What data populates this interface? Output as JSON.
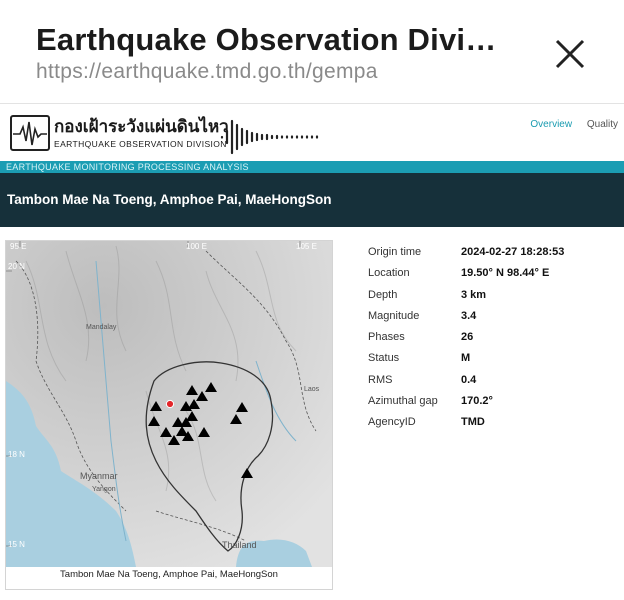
{
  "browser": {
    "page_title": "Earthquake Observation Divis…",
    "url": "https://earthquake.tmd.go.th/gempa"
  },
  "site": {
    "logo_thai": "กองเฝ้าระวังแผ่นดินไหว",
    "logo_english": "EARTHQUAKE OBSERVATION DIVISION",
    "nav": [
      "Overview",
      "Quality"
    ],
    "subtitle": "EARTHQUAKE  MONITORING  PROCESSING  ANALYSIS"
  },
  "event": {
    "title": "Tambon Mae Na Toeng, Amphoe Pai, MaeHongSon"
  },
  "map": {
    "lon_labels": [
      "95 E",
      "100 E",
      "105 E"
    ],
    "lat_labels": [
      "20 N",
      "18 N",
      "15 N"
    ],
    "place_labels": [
      "Mandalay",
      "Myanmar",
      "Yangon",
      "Laos",
      "Thailand"
    ],
    "caption": "Tambon Mae Na Toeng, Amphoe Pai, MaeHongSon",
    "epicenter_color": "#e3262a",
    "station_color": "#000000",
    "station_count": 18
  },
  "details": [
    {
      "label": "Origin time",
      "value": "2024-02-27 18:28:53"
    },
    {
      "label": "Location",
      "value": "19.50° N   98.44° E"
    },
    {
      "label": "Depth",
      "value": "3 km"
    },
    {
      "label": "Magnitude",
      "value": "3.4"
    },
    {
      "label": "Phases",
      "value": "26"
    },
    {
      "label": "Status",
      "value": "M"
    },
    {
      "label": "RMS",
      "value": "0.4"
    },
    {
      "label": "Azimuthal gap",
      "value": "170.2°"
    },
    {
      "label": "AgencyID",
      "value": "TMD"
    }
  ],
  "colors": {
    "accent": "#1b9db3",
    "header_dark": "#16303a"
  }
}
